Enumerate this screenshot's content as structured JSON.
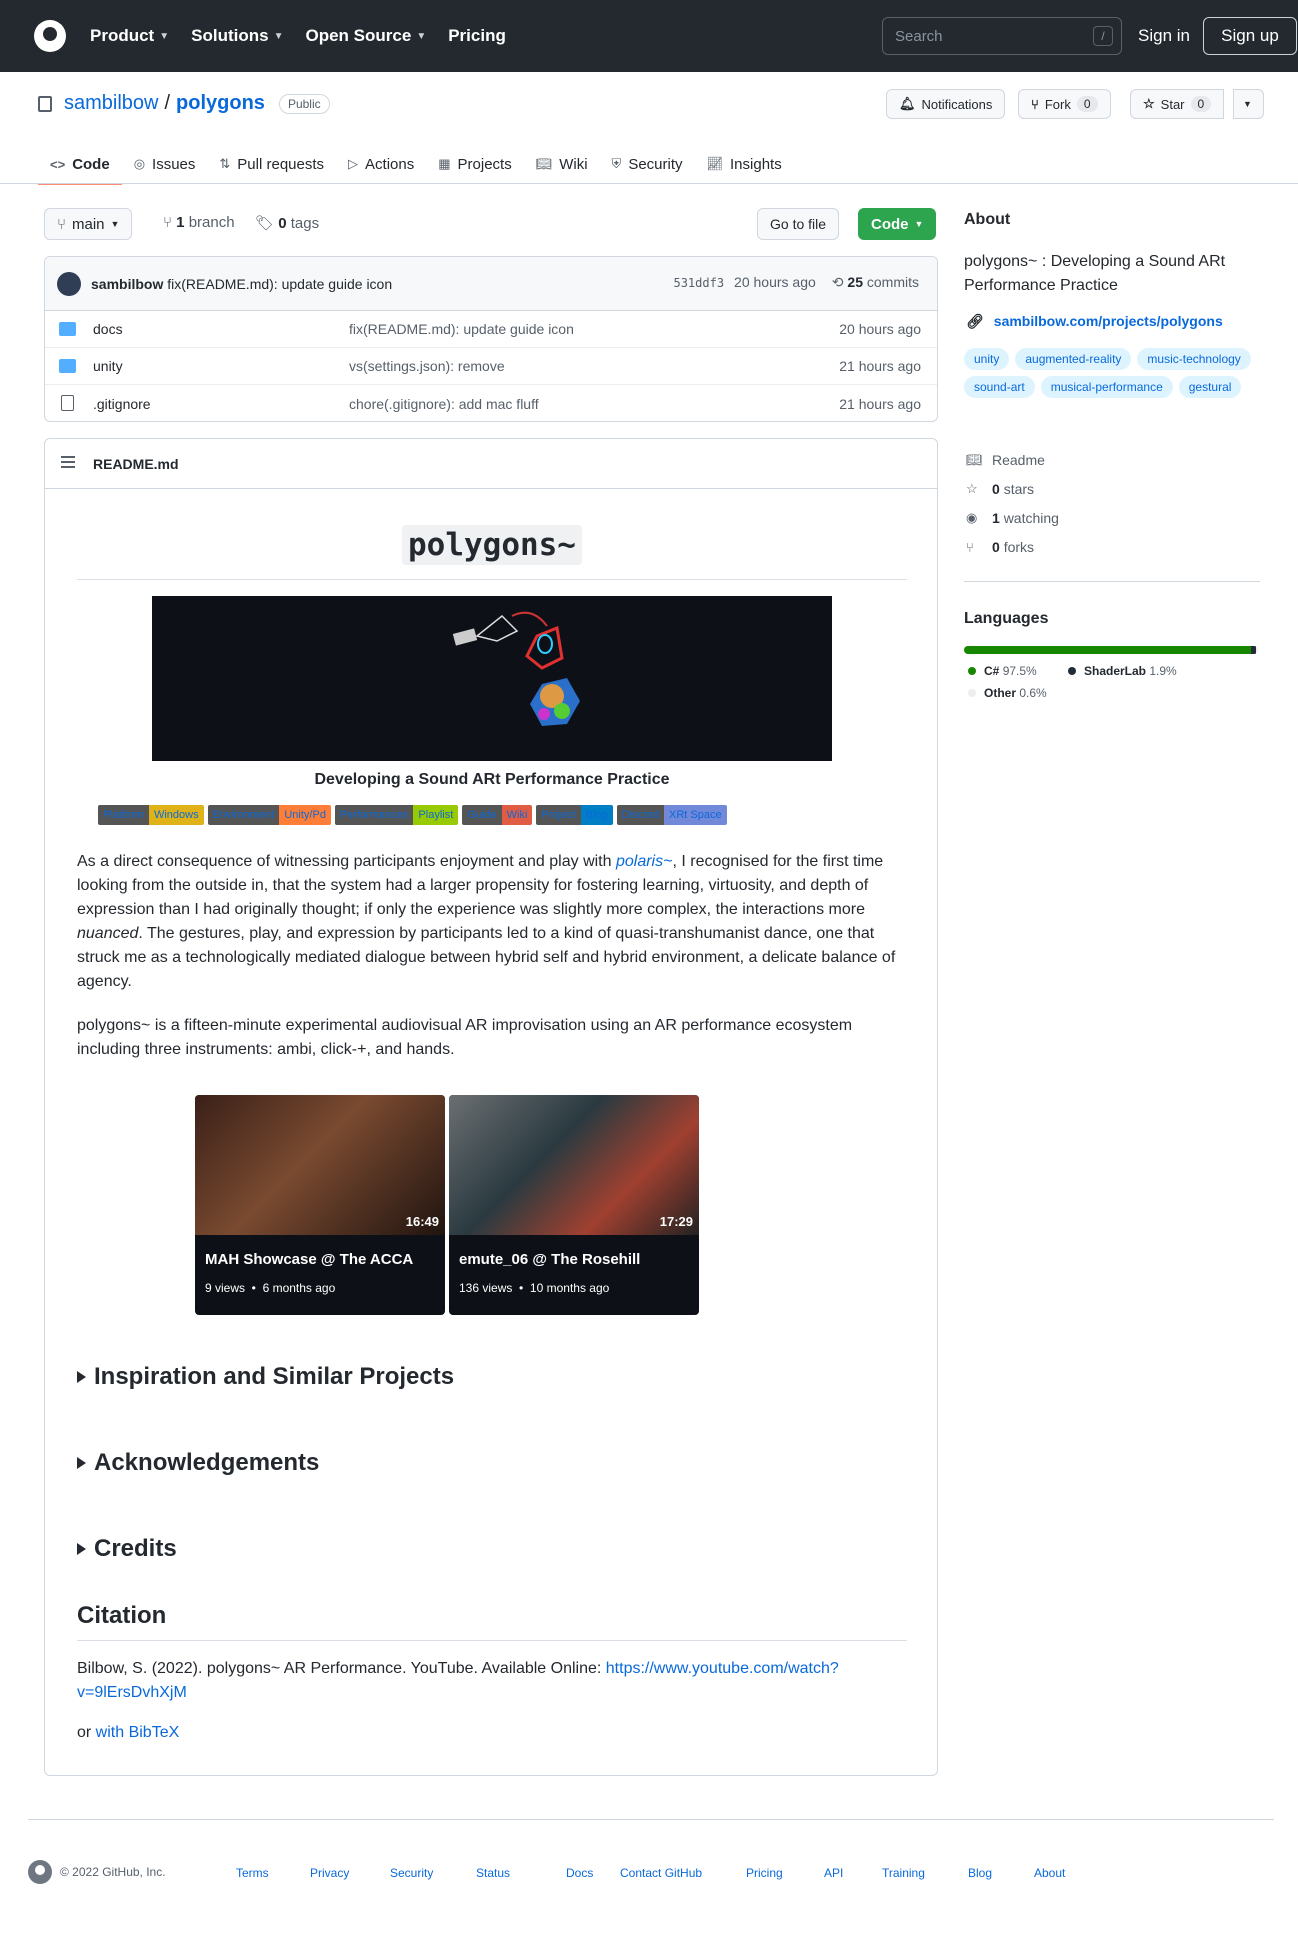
{
  "header": {
    "nav": [
      "Product",
      "Solutions",
      "Open Source",
      "Pricing"
    ],
    "search_placeholder": "Search",
    "search_key": "/",
    "signin": "Sign in",
    "signup": "Sign up"
  },
  "repo": {
    "owner": "sambilbow",
    "sep": "/",
    "name": "polygons",
    "visibility": "Public",
    "notifications": "Notifications",
    "fork_label": "Fork",
    "fork_count": "0",
    "star_label": "Star",
    "star_count": "0"
  },
  "tabs": [
    "Code",
    "Issues",
    "Pull requests",
    "Actions",
    "Projects",
    "Wiki",
    "Security",
    "Insights"
  ],
  "branch": {
    "current": "main",
    "branches_count": "1",
    "branches_label": "branch",
    "tags_count": "0",
    "tags_label": "tags",
    "goto_file": "Go to file",
    "code": "Code"
  },
  "commit": {
    "author": "sambilbow",
    "message": "fix(README.md): update guide icon",
    "sha": "531ddf3",
    "age": "20 hours ago",
    "count": "25",
    "count_label": "commits"
  },
  "files": [
    {
      "name": "docs",
      "type": "dir",
      "message": "fix(README.md): update guide icon",
      "age": "20 hours ago"
    },
    {
      "name": "unity",
      "type": "dir",
      "message": "vs(settings.json): remove",
      "age": "21 hours ago"
    },
    {
      "name": ".gitignore",
      "type": "file",
      "message": "chore(.gitignore): add mac fluff",
      "age": "21 hours ago"
    }
  ],
  "readme": {
    "filename": "README.md",
    "title": "polygons~",
    "tagline": "Developing a Sound ARt Performance Practice",
    "badges": [
      {
        "label": "Platform",
        "value": "Windows",
        "color": "#dfb317"
      },
      {
        "label": "Environment",
        "value": "Unity/Pd",
        "color": "#fe7d37"
      },
      {
        "label": "Performances",
        "value": "Playlist",
        "color": "#97ca00"
      },
      {
        "label": "Guide",
        "value": "Wiki",
        "color": "#e05d44"
      },
      {
        "label": "Project",
        "value": "Blog",
        "color": "#007ec6"
      },
      {
        "label": "Discord",
        "value": "XRt Space",
        "color": "#7289da"
      }
    ],
    "p1_pre": "As a direct consequence of witnessing participants enjoyment and play with ",
    "p1_link": "polaris~",
    "p1_mid": ", I recognised for the first time looking from the outside in, that the system had a larger propensity for fostering learning, virtuosity, and depth of expression than I had originally thought; if only the experience was slightly more complex, the interactions more ",
    "p1_em": "nuanced",
    "p1_post": ". The gestures, play, and expression by participants led to a kind of quasi-transhumanist dance, one that struck me as a technologically mediated dialogue between hybrid self and hybrid environment, a delicate balance of agency.",
    "p2": "polygons~ is a fifteen-minute experimental audiovisual AR improvisation using an AR performance ecosystem including three instruments: ambi, click-+, and hands.",
    "videos": [
      {
        "title": "MAH Showcase @ The ACCA",
        "duration": "16:49",
        "views": "9 views",
        "age": "6 months ago"
      },
      {
        "title": "emute_06 @ The Rosehill",
        "duration": "17:29",
        "views": "136 views",
        "age": "10 months ago"
      }
    ],
    "details": [
      "Inspiration and Similar Projects",
      "Acknowledgements",
      "Credits"
    ],
    "citation_heading": "Citation",
    "citation_text": "Bilbow, S. (2022). polygons~ AR Performance. YouTube. Available Online: ",
    "citation_url_1": "https://www.youtube.com/watch?",
    "citation_url_2": "v=9lErsDvhXjM",
    "or": "or ",
    "bibtex": "with BibTeX"
  },
  "about": {
    "heading": "About",
    "description": "polygons~ : Developing a Sound ARt Performance Practice",
    "link": "sambilbow.com/projects/polygons",
    "topics": [
      "unity",
      "augmented-reality",
      "music-technology",
      "sound-art",
      "musical-performance",
      "gestural"
    ],
    "readme": "Readme",
    "stars_count": "0",
    "stars_label": "stars",
    "watching_count": "1",
    "watching_label": "watching",
    "forks_count": "0",
    "forks_label": "forks"
  },
  "languages": {
    "heading": "Languages",
    "items": [
      {
        "name": "C#",
        "percent": "97.5%",
        "value": 97.5,
        "color": "#178600"
      },
      {
        "name": "ShaderLab",
        "percent": "1.9%",
        "value": 1.9,
        "color": "#222c37"
      },
      {
        "name": "Other",
        "percent": "0.6%",
        "value": 0.6,
        "color": "#ededed"
      }
    ]
  },
  "footer": {
    "copyright": "© 2022 GitHub, Inc.",
    "links": [
      "Terms",
      "Privacy",
      "Security",
      "Status",
      "Docs",
      "Contact GitHub",
      "Pricing",
      "API",
      "Training",
      "Blog",
      "About"
    ]
  }
}
